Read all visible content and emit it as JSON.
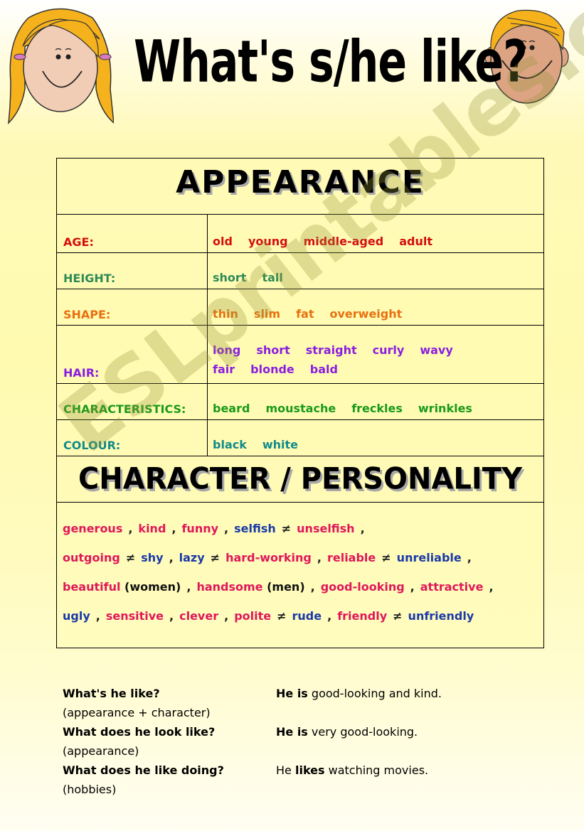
{
  "title": "What's s/he like?",
  "watermark": "ESLprintables.com",
  "illustrations": {
    "left": "girl-face-icon",
    "right": "boy-face-icon"
  },
  "appearance": {
    "heading": "APPEARANCE",
    "rows": [
      {
        "label": "AGE:",
        "color": "#d40f0f",
        "values": [
          "old",
          "young",
          "middle-aged",
          "adult"
        ]
      },
      {
        "label": "HEIGHT:",
        "color": "#2e8b57",
        "values": [
          "short",
          "tall"
        ]
      },
      {
        "label": "SHAPE:",
        "color": "#e8700f",
        "values": [
          "thin",
          "slim",
          "fat",
          "overweight"
        ]
      },
      {
        "label": "HAIR:",
        "color": "#8a1ee0",
        "values": [
          "long",
          "short",
          "straight",
          "curly",
          "wavy",
          "fair",
          "blonde",
          "bald"
        ]
      },
      {
        "label": "CHARACTERISTICS:",
        "color": "#1a9a1a",
        "values": [
          "beard",
          "moustache",
          "freckles",
          "wrinkles"
        ]
      },
      {
        "label": "COLOUR:",
        "color": "#138a8a",
        "values": [
          "black",
          "white"
        ]
      }
    ]
  },
  "character": {
    "heading": "CHARACTER / PERSONALITY",
    "lines": [
      [
        {
          "t": "generous",
          "c": "pk"
        },
        {
          "t": ",",
          "c": "sep"
        },
        {
          "t": "kind",
          "c": "pk"
        },
        {
          "t": ",",
          "c": "sep"
        },
        {
          "t": "funny",
          "c": "pk"
        },
        {
          "t": ",",
          "c": "sep"
        },
        {
          "t": "selfish",
          "c": "bl"
        },
        {
          "t": "≠",
          "c": "sep"
        },
        {
          "t": "unselfish",
          "c": "pk"
        },
        {
          "t": ",",
          "c": "sep"
        }
      ],
      [
        {
          "t": "outgoing",
          "c": "pk"
        },
        {
          "t": "≠",
          "c": "sep"
        },
        {
          "t": "shy",
          "c": "bl"
        },
        {
          "t": ",",
          "c": "sep"
        },
        {
          "t": "lazy",
          "c": "bl"
        },
        {
          "t": "≠",
          "c": "sep"
        },
        {
          "t": "hard-working",
          "c": "pk"
        },
        {
          "t": ",",
          "c": "sep"
        },
        {
          "t": "reliable",
          "c": "pk"
        },
        {
          "t": "≠",
          "c": "sep"
        },
        {
          "t": "unreliable",
          "c": "bl"
        },
        {
          "t": ",",
          "c": "sep"
        }
      ],
      [
        {
          "t": "beautiful",
          "c": "pk"
        },
        {
          "t": " (women)",
          "c": "bk"
        },
        {
          "t": ",",
          "c": "sep"
        },
        {
          "t": "handsome",
          "c": "pk"
        },
        {
          "t": " (men)",
          "c": "bk"
        },
        {
          "t": ",",
          "c": "sep"
        },
        {
          "t": "good-looking",
          "c": "pk"
        },
        {
          "t": ",",
          "c": "sep"
        },
        {
          "t": "attractive",
          "c": "pk"
        },
        {
          "t": ",",
          "c": "sep"
        }
      ],
      [
        {
          "t": "ugly",
          "c": "bl"
        },
        {
          "t": ",",
          "c": "sep"
        },
        {
          "t": "sensitive",
          "c": "pk"
        },
        {
          "t": ",",
          "c": "sep"
        },
        {
          "t": "clever",
          "c": "pk"
        },
        {
          "t": ",",
          "c": "sep"
        },
        {
          "t": "polite",
          "c": "pk"
        },
        {
          "t": "≠",
          "c": "sep"
        },
        {
          "t": "rude",
          "c": "bl"
        },
        {
          "t": ",",
          "c": "sep"
        },
        {
          "t": "friendly",
          "c": "pk"
        },
        {
          "t": "≠",
          "c": "sep"
        },
        {
          "t": "unfriendly",
          "c": "bl"
        }
      ]
    ]
  },
  "questions": [
    {
      "question": "What's he like?",
      "note": "(appearance + character)",
      "answer": [
        {
          "t": "He is",
          "b": true
        },
        {
          "t": " good-looking and kind.",
          "b": false
        }
      ]
    },
    {
      "question": "What does he look like?",
      "note": "(appearance)",
      "answer": [
        {
          "t": "He is",
          "b": true
        },
        {
          "t": " very good-looking.",
          "b": false
        }
      ]
    },
    {
      "question": "What does he like doing?",
      "note": "(hobbies)",
      "answer": [
        {
          "t": "He ",
          "b": false
        },
        {
          "t": "likes",
          "b": true
        },
        {
          "t": " watching",
          "b": false
        },
        {
          "t": " movies.",
          "b": false
        }
      ]
    }
  ]
}
